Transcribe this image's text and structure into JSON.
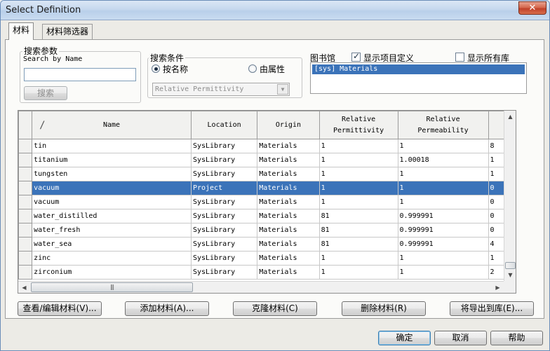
{
  "window": {
    "title": "Select Definition",
    "close_glyph": "✕"
  },
  "tabs": [
    {
      "label": "材料",
      "active": true
    },
    {
      "label": "材料筛选器",
      "active": false
    }
  ],
  "search_params": {
    "group_label": "搜索参数",
    "name_label": "Search by Name",
    "name_value": "",
    "search_button": "搜索"
  },
  "search_criteria": {
    "group_label": "搜索条件",
    "by_name": "按名称",
    "by_property": "由属性",
    "selected": "by_name",
    "property_select": "Relative Permittivity"
  },
  "libraries": {
    "label": "图书馆",
    "show_project_label": "显示项目定义",
    "show_project_checked": true,
    "show_all_label": "显示所有库",
    "show_all_checked": false,
    "items": [
      "[sys] Materials"
    ]
  },
  "grid": {
    "columns": [
      {
        "key": "sort",
        "label": "/"
      },
      {
        "key": "name",
        "label": "Name"
      },
      {
        "key": "location",
        "label": "Location"
      },
      {
        "key": "origin",
        "label": "Origin"
      },
      {
        "key": "permittivity",
        "label": "Relative\nPermittivity"
      },
      {
        "key": "permeability",
        "label": "Relative\nPermeability"
      },
      {
        "key": "extra",
        "label": ""
      }
    ],
    "rows": [
      {
        "name": "tin",
        "location": "SysLibrary",
        "origin": "Materials",
        "permittivity": "1",
        "permeability": "1",
        "extra": "8",
        "selected": false
      },
      {
        "name": "titanium",
        "location": "SysLibrary",
        "origin": "Materials",
        "permittivity": "1",
        "permeability": "1.00018",
        "extra": "1",
        "selected": false
      },
      {
        "name": "tungsten",
        "location": "SysLibrary",
        "origin": "Materials",
        "permittivity": "1",
        "permeability": "1",
        "extra": "1",
        "selected": false
      },
      {
        "name": "vacuum",
        "location": "Project",
        "origin": "Materials",
        "permittivity": "1",
        "permeability": "1",
        "extra": "0",
        "selected": true
      },
      {
        "name": "vacuum",
        "location": "SysLibrary",
        "origin": "Materials",
        "permittivity": "1",
        "permeability": "1",
        "extra": "0",
        "selected": false
      },
      {
        "name": "water_distilled",
        "location": "SysLibrary",
        "origin": "Materials",
        "permittivity": "81",
        "permeability": "0.999991",
        "extra": "0",
        "selected": false
      },
      {
        "name": "water_fresh",
        "location": "SysLibrary",
        "origin": "Materials",
        "permittivity": "81",
        "permeability": "0.999991",
        "extra": "0",
        "selected": false
      },
      {
        "name": "water_sea",
        "location": "SysLibrary",
        "origin": "Materials",
        "permittivity": "81",
        "permeability": "0.999991",
        "extra": "4",
        "selected": false
      },
      {
        "name": "zinc",
        "location": "SysLibrary",
        "origin": "Materials",
        "permittivity": "1",
        "permeability": "1",
        "extra": "1",
        "selected": false
      },
      {
        "name": "zirconium",
        "location": "SysLibrary",
        "origin": "Materials",
        "permittivity": "1",
        "permeability": "1",
        "extra": "2",
        "selected": false
      }
    ],
    "scroll_up_glyph": "▲",
    "scroll_down_glyph": "▼",
    "scroll_left_glyph": "◀",
    "scroll_right_glyph": "▶",
    "thumb_grip": "|||"
  },
  "actions": {
    "view_edit": "查看/编辑材料(V)...",
    "add": "添加材料(A)...",
    "clone": "克隆材料(C)",
    "delete": "删除材料(R)",
    "export": "将导出到库(E)..."
  },
  "footer": {
    "ok": "确定",
    "cancel": "取消",
    "help": "帮助"
  },
  "colors": {
    "selection": "#3b73b9",
    "titlebar": "#c6d8ee",
    "close": "#c0412a"
  }
}
